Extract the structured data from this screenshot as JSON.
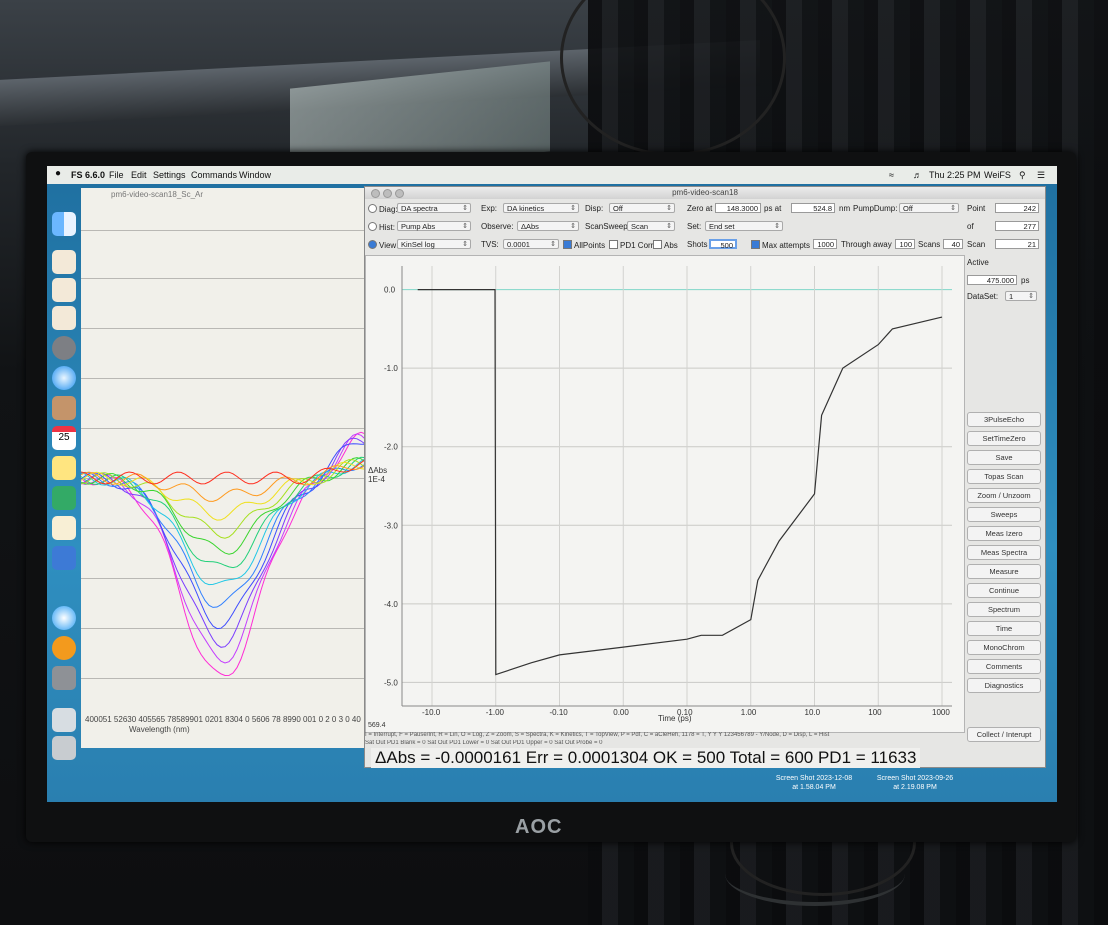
{
  "menubar": {
    "app": "FS 6.6.0",
    "items": [
      "File",
      "Edit",
      "Settings",
      "Commands",
      "Window"
    ],
    "clock": "Thu 2:25 PM",
    "user": "WeiFS"
  },
  "left_window": {
    "title": "pm6-video-scan18_Sc_Ar",
    "x_ticks": "400051 52630 405565 78589901 0201 8304 0 5606 78 8990 001 0 2 0 3 0 40",
    "x_label": "Wavelength (nm)"
  },
  "main_window": {
    "title": "pm6-video-scan18",
    "controls": {
      "diag_label": "Diag:",
      "diag_value": "DA spectra",
      "hist_label": "Hist:",
      "hist_value": "Pump Abs",
      "view_label": "View:",
      "view_value": "KinSel log",
      "exp_label": "Exp:",
      "exp_value": "DA kinetics",
      "observe_label": "Observe:",
      "observe_value": "ΔAbs",
      "tvs_label": "TVS:",
      "tvs_value": "0.0001",
      "allpoints_label": "AllPoints",
      "pd1corr_label": "PD1 Corr",
      "abs_label": "Abs",
      "disp_label": "Disp:",
      "disp_value": "Off",
      "scansweep_label": "ScanSweep:",
      "scansweep_value": "Scan",
      "zero_label": "Zero at",
      "zero_value": "148.3000",
      "ps_at_label": "ps at",
      "nm_value": "524.8",
      "nm_label": "nm",
      "set_label": "Set:",
      "set_value": "End set",
      "shots_label": "Shots",
      "shots_value": "500",
      "max_attempts_label": "Max attempts",
      "max_attempts_value": "1000",
      "through_away_label": "Through away",
      "through_away_value": "100",
      "scans_label": "Scans",
      "scans_value": "40",
      "pumpdump_label": "PumpDump:",
      "pumpdump_value": "Off"
    },
    "right_panel": {
      "point_label": "Point",
      "point_value": "242",
      "of_label": "of",
      "of_value": "277",
      "scan_label": "Scan",
      "scan_value": "21",
      "active_label": "Active",
      "ps_value": "475.000",
      "ps_label": "ps",
      "dataset_label": "DataSet:",
      "dataset_value": "1"
    },
    "buttons": [
      "3PulseEcho",
      "SetTimeZero",
      "Save",
      "Topas Scan",
      "Zoom / Unzoom",
      "Sweeps",
      "Meas Izero",
      "Meas Spectra",
      "Measure",
      "Continue",
      "Spectrum",
      "Time",
      "MonoChrom",
      "Comments",
      "Diagnostics"
    ],
    "collect_button": "Collect / Interupt",
    "plot": {
      "y_label": "ΔAbs\n1E-4",
      "y_ticks": [
        "0.0",
        "-1.0",
        "-2.0",
        "-3.0",
        "-4.0",
        "-5.0"
      ],
      "x_ticks": [
        "-10.0",
        "-1.00",
        "-0.10",
        "0.00",
        "0.10",
        "1.00",
        "10.0",
        "100",
        "1000"
      ],
      "x_label": "Time (ps)",
      "corner_value": "569.4"
    },
    "status_line_1": "I = Interrupt, F = Pause/Int, R = Lin, O = Log, Z = Zoom, S = Spectra, K = Kinetics, T = TopView, P = Pdf, C = aCleHeh, 1178 = T, Y Y Y 123456789 - Y/Node, D = Disp, L = Hist",
    "status_line_2": "Sat Out PD1 Blank = 0 Sat Out PD1 Lower = 0 Sat Out PD1 Upper = 0 Sat Out Probe = 0"
  },
  "readout": "ΔAbs = -0.0000161 Err = 0.0001304 OK = 500 Total = 600 PD1 = 11633",
  "desktop_icons": [
    {
      "line1": "Screen Shot 2023-12-08",
      "line2": "at 1.58.04 PM"
    },
    {
      "line1": "Screen Shot 2023-09-26",
      "line2": "at 2.19.08 PM"
    }
  ],
  "monitor_brand": "AOC",
  "kinetic_trace": {
    "type": "line",
    "x_scale": "log",
    "x_unit": "ps",
    "y_unit": "ΔAbs 1E-4",
    "ylim": [
      -5.3,
      0.3
    ],
    "approx_x": [
      -30,
      -3,
      -1.1,
      -1.0,
      -0.5,
      -0.1,
      0.0,
      0.1,
      0.3,
      0.6,
      1.0,
      2,
      5,
      10,
      20,
      50,
      100,
      300,
      1000
    ],
    "approx_y": [
      0.0,
      0.0,
      0.0,
      -4.9,
      -4.75,
      -4.65,
      -4.55,
      -4.45,
      -4.4,
      -4.4,
      -4.2,
      -3.7,
      -3.2,
      -2.6,
      -1.6,
      -1.0,
      -0.7,
      -0.5,
      -0.35
    ]
  },
  "spectra_series_colors": [
    "#ff2bd6",
    "#c33cff",
    "#7a3cff",
    "#3e4cff",
    "#2f7fff",
    "#1fc7e6",
    "#22d07a",
    "#3ad52e",
    "#a6e01e",
    "#f0e01e",
    "#ff9a1e",
    "#ff2e1e"
  ]
}
